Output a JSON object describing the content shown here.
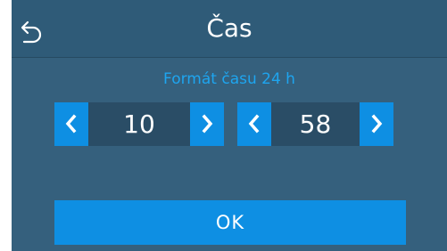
{
  "header": {
    "title": "Čas",
    "back_icon": "back-arrow-icon"
  },
  "time_format_label": "Formát času 24 h",
  "hours": {
    "value": "10",
    "decrement_icon": "chevron-left-icon",
    "increment_icon": "chevron-right-icon"
  },
  "minutes": {
    "value": "58",
    "decrement_icon": "chevron-left-icon",
    "increment_icon": "chevron-right-icon"
  },
  "confirm": {
    "label": "OK"
  },
  "colors": {
    "background": "#35607d",
    "header": "#2f5b78",
    "accent": "#0e8fe3",
    "label_blue": "#1ea5ef",
    "value_box": "#2a4d66"
  }
}
